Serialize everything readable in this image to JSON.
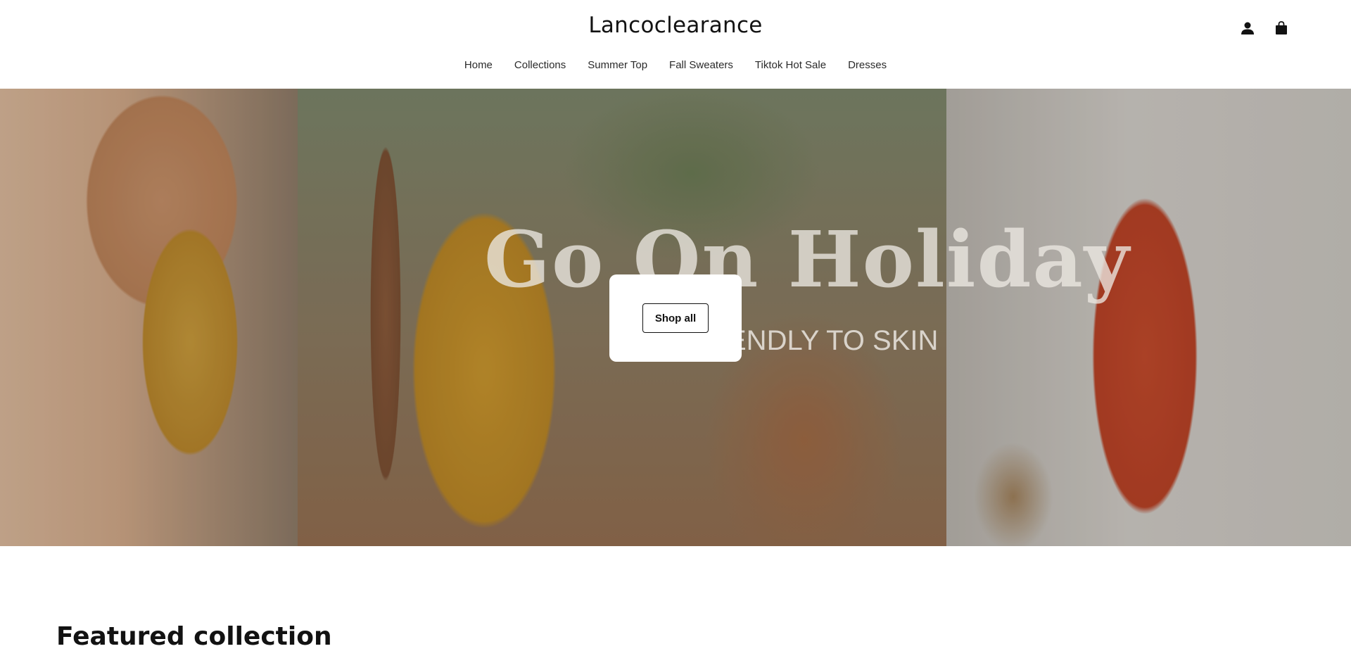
{
  "header": {
    "logo": "Lancoclearance",
    "icons": [
      "account-icon",
      "cart-icon"
    ]
  },
  "nav": {
    "items": [
      "Home",
      "Collections",
      "Summer Top",
      "Fall Sweaters",
      "Tiktok Hot Sale",
      "Dresses"
    ]
  },
  "hero": {
    "headline": "Go On Holiday",
    "subline": "ENDLY TO SKIN",
    "button_label": "Shop all"
  },
  "featured": {
    "title": "Featured collection"
  },
  "colors": {
    "text": "#121212",
    "background": "#ffffff"
  }
}
